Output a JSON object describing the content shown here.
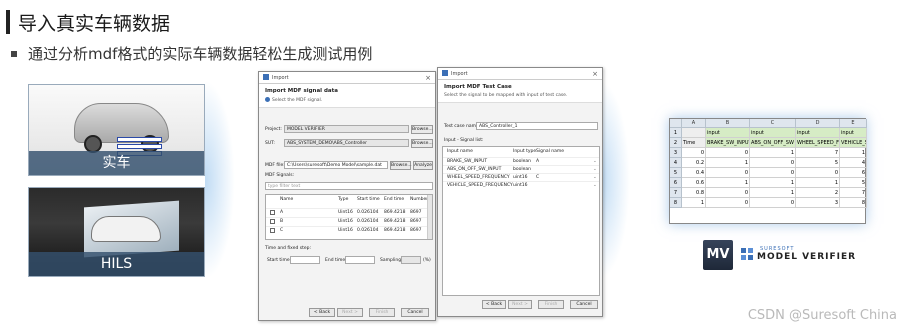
{
  "header": {
    "title": "导入真实车辆数据",
    "subtitle": "通过分析mdf格式的实际车辆数据轻松生成测试用例"
  },
  "cards": {
    "car_label": "实车",
    "hils_label": "HILS"
  },
  "dialog1": {
    "window_title": "Import",
    "heading": "Import MDF signal data",
    "subheading": "Select the MDF signal.",
    "project_label": "Project:",
    "project_value": "MODEL VERIFIER",
    "sut_label": "SUT:",
    "sut_value": "ABS_SYSTEM_DEMO\\ABS_Controller",
    "mdf_label": "MDF file:",
    "mdf_value": "C:\\Users\\suresoft\\Demo Model\\sample.dat",
    "browse_label": "Browse...",
    "analyze_label": "Analyze",
    "signals_label": "MDF Signals:",
    "filter_placeholder": "type filter text",
    "columns": [
      "Name",
      "Type",
      "Start time",
      "End time",
      "Number"
    ],
    "rows": [
      [
        "A",
        "Uint16",
        "0.026104",
        "869.4218",
        "8697"
      ],
      [
        "B",
        "Uint16",
        "0.026104",
        "869.4218",
        "8697"
      ],
      [
        "C",
        "Uint16",
        "0.026104",
        "869.4218",
        "8697"
      ]
    ],
    "step_label": "Time and fixed step:",
    "start_label": "Start time:",
    "end_label": "End time:",
    "sampling_label": "Sampling:",
    "percent_label": "(%)",
    "back": "< Back",
    "next": "Next >",
    "finish": "Finish",
    "cancel": "Cancel"
  },
  "dialog2": {
    "window_title": "Import",
    "heading": "Import MDF Test Case",
    "subheading": "Select the signal to be mapped with input of test case.",
    "name_label": "Test case name:",
    "name_value": "ABS_Controller_1",
    "signal_list_label": "Input - Signal list:",
    "columns": [
      "Input name",
      "Input type",
      "Signal name"
    ],
    "rows": [
      [
        "BRAKE_SW_INPUT",
        "boolean",
        "A"
      ],
      [
        "ABS_ON_OFF_SW_INPUT",
        "boolean",
        ""
      ],
      [
        "WHEEL_SPEED_FREQUENCY",
        "uint16",
        "C"
      ],
      [
        "VEHICLE_SPEED_FREQUENCY",
        "uint16",
        ""
      ]
    ],
    "back": "< Back",
    "next": "Next >",
    "finish": "Finish",
    "cancel": "Cancel"
  },
  "sheet": {
    "col_headers": [
      "A",
      "B",
      "C",
      "D",
      "E"
    ],
    "row_numbers": [
      "1",
      "2",
      "3",
      "4",
      "5",
      "6",
      "7",
      "8"
    ],
    "row1": [
      "",
      "input",
      "input",
      "input",
      "input"
    ],
    "row2": [
      "Time",
      "BRAKE_SW_INPUT",
      "ABS_ON_OFF_SW",
      "WHEEL_SPEED_F",
      "VEHICLE_SPEED_F"
    ],
    "data": [
      [
        "0",
        "0",
        "1",
        "7",
        "1"
      ],
      [
        "0.2",
        "1",
        "0",
        "5",
        "4"
      ],
      [
        "0.4",
        "0",
        "0",
        "0",
        "6"
      ],
      [
        "0.6",
        "1",
        "1",
        "1",
        "5"
      ],
      [
        "0.8",
        "0",
        "1",
        "2",
        "7"
      ],
      [
        "1",
        "0",
        "0",
        "3",
        "8"
      ]
    ]
  },
  "brand": {
    "logo_text": "MV",
    "small": "SURESOFT",
    "name": "MODEL VERIFIER"
  },
  "watermark": "CSDN @Suresoft China",
  "colors": {
    "accent": "#3b6fb6",
    "sheet_green": "#d6ecc5",
    "card_label_bg": "#34506e"
  }
}
